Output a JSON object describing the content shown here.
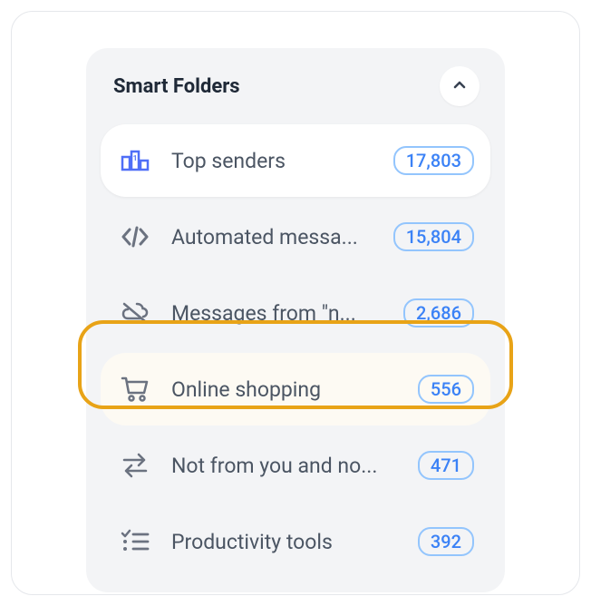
{
  "panel": {
    "title": "Smart Folders"
  },
  "folders": [
    {
      "label": "Top senders",
      "count": "17,803"
    },
    {
      "label": "Automated messa...",
      "count": "15,804"
    },
    {
      "label": "Messages from \"n...",
      "count": "2,686"
    },
    {
      "label": "Online shopping",
      "count": "556"
    },
    {
      "label": "Not from you and no...",
      "count": "471"
    },
    {
      "label": "Productivity tools",
      "count": "392"
    }
  ]
}
